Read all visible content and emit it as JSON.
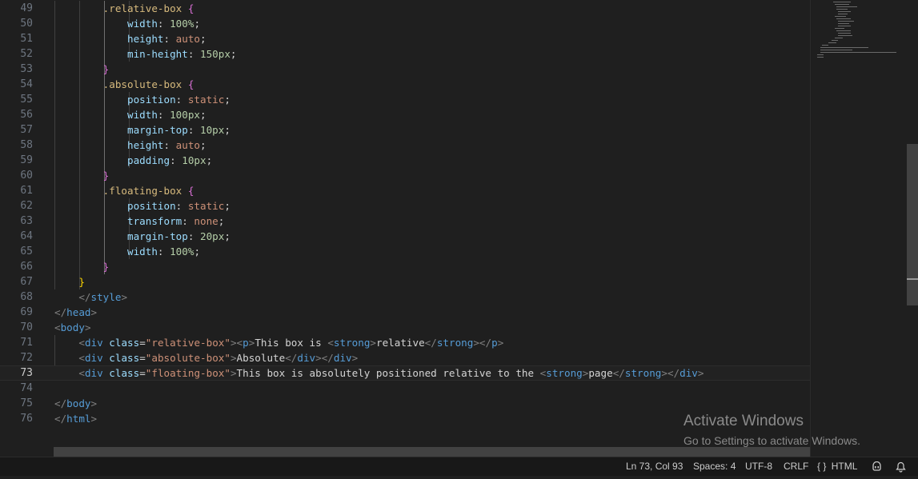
{
  "editor": {
    "lines": [
      {
        "number": "49",
        "tokens": [
          [
            "        ",
            ""
          ],
          [
            ".relative-box",
            "t-sel"
          ],
          [
            " ",
            "t-pun"
          ],
          [
            "{",
            "t-br2"
          ]
        ]
      },
      {
        "number": "50",
        "tokens": [
          [
            "            ",
            ""
          ],
          [
            "width",
            "t-prop"
          ],
          [
            ": ",
            "t-pun"
          ],
          [
            "100%",
            "t-num"
          ],
          [
            ";",
            "t-pun"
          ]
        ]
      },
      {
        "number": "51",
        "tokens": [
          [
            "            ",
            ""
          ],
          [
            "height",
            "t-prop"
          ],
          [
            ": ",
            "t-pun"
          ],
          [
            "auto",
            "t-val"
          ],
          [
            ";",
            "t-pun"
          ]
        ]
      },
      {
        "number": "52",
        "tokens": [
          [
            "            ",
            ""
          ],
          [
            "min-height",
            "t-prop"
          ],
          [
            ": ",
            "t-pun"
          ],
          [
            "150px",
            "t-num"
          ],
          [
            ";",
            "t-pun"
          ]
        ]
      },
      {
        "number": "53",
        "tokens": [
          [
            "        ",
            ""
          ],
          [
            "}",
            "t-br2"
          ]
        ]
      },
      {
        "number": "54",
        "tokens": [
          [
            "        ",
            ""
          ],
          [
            ".absolute-box",
            "t-sel"
          ],
          [
            " ",
            "t-pun"
          ],
          [
            "{",
            "t-br2"
          ]
        ]
      },
      {
        "number": "55",
        "tokens": [
          [
            "            ",
            ""
          ],
          [
            "position",
            "t-prop"
          ],
          [
            ": ",
            "t-pun"
          ],
          [
            "static",
            "t-val"
          ],
          [
            ";",
            "t-pun"
          ]
        ]
      },
      {
        "number": "56",
        "tokens": [
          [
            "            ",
            ""
          ],
          [
            "width",
            "t-prop"
          ],
          [
            ": ",
            "t-pun"
          ],
          [
            "100px",
            "t-num"
          ],
          [
            ";",
            "t-pun"
          ]
        ]
      },
      {
        "number": "57",
        "tokens": [
          [
            "            ",
            ""
          ],
          [
            "margin-top",
            "t-prop"
          ],
          [
            ": ",
            "t-pun"
          ],
          [
            "10px",
            "t-num"
          ],
          [
            ";",
            "t-pun"
          ]
        ]
      },
      {
        "number": "58",
        "tokens": [
          [
            "            ",
            ""
          ],
          [
            "height",
            "t-prop"
          ],
          [
            ": ",
            "t-pun"
          ],
          [
            "auto",
            "t-val"
          ],
          [
            ";",
            "t-pun"
          ]
        ]
      },
      {
        "number": "59",
        "tokens": [
          [
            "            ",
            ""
          ],
          [
            "padding",
            "t-prop"
          ],
          [
            ": ",
            "t-pun"
          ],
          [
            "10px",
            "t-num"
          ],
          [
            ";",
            "t-pun"
          ]
        ]
      },
      {
        "number": "60",
        "tokens": [
          [
            "        ",
            ""
          ],
          [
            "}",
            "t-br2"
          ]
        ]
      },
      {
        "number": "61",
        "tokens": [
          [
            "        ",
            ""
          ],
          [
            ".floating-box",
            "t-sel"
          ],
          [
            " ",
            "t-pun"
          ],
          [
            "{",
            "t-br2"
          ]
        ]
      },
      {
        "number": "62",
        "tokens": [
          [
            "            ",
            ""
          ],
          [
            "position",
            "t-prop"
          ],
          [
            ": ",
            "t-pun"
          ],
          [
            "static",
            "t-val"
          ],
          [
            ";",
            "t-pun"
          ]
        ]
      },
      {
        "number": "63",
        "tokens": [
          [
            "            ",
            ""
          ],
          [
            "transform",
            "t-prop"
          ],
          [
            ": ",
            "t-pun"
          ],
          [
            "none",
            "t-val"
          ],
          [
            ";",
            "t-pun"
          ]
        ]
      },
      {
        "number": "64",
        "tokens": [
          [
            "            ",
            ""
          ],
          [
            "margin-top",
            "t-prop"
          ],
          [
            ": ",
            "t-pun"
          ],
          [
            "20px",
            "t-num"
          ],
          [
            ";",
            "t-pun"
          ]
        ]
      },
      {
        "number": "65",
        "tokens": [
          [
            "            ",
            ""
          ],
          [
            "width",
            "t-prop"
          ],
          [
            ": ",
            "t-pun"
          ],
          [
            "100%",
            "t-num"
          ],
          [
            ";",
            "t-pun"
          ]
        ]
      },
      {
        "number": "66",
        "tokens": [
          [
            "        ",
            ""
          ],
          [
            "}",
            "t-br2"
          ]
        ]
      },
      {
        "number": "67",
        "tokens": [
          [
            "    ",
            ""
          ],
          [
            "}",
            "t-br1"
          ]
        ]
      },
      {
        "number": "68",
        "tokens": [
          [
            "    ",
            ""
          ],
          [
            "</",
            "t-tb"
          ],
          [
            "style",
            "t-tag"
          ],
          [
            ">",
            "t-tb"
          ]
        ]
      },
      {
        "number": "69",
        "tokens": [
          [
            "</",
            "t-tb"
          ],
          [
            "head",
            "t-tag"
          ],
          [
            ">",
            "t-tb"
          ]
        ]
      },
      {
        "number": "70",
        "tokens": [
          [
            "<",
            "t-tb"
          ],
          [
            "body",
            "t-tag"
          ],
          [
            ">",
            "t-tb"
          ]
        ]
      },
      {
        "number": "71",
        "tokens": [
          [
            "    ",
            ""
          ],
          [
            "<",
            "t-tb"
          ],
          [
            "div",
            "t-tag"
          ],
          [
            " ",
            "t-text"
          ],
          [
            "class",
            "t-attr"
          ],
          [
            "=",
            "t-text"
          ],
          [
            "\"relative-box\"",
            "t-str"
          ],
          [
            "><",
            "t-tb"
          ],
          [
            "p",
            "t-tag"
          ],
          [
            ">",
            "t-tb"
          ],
          [
            "This box is ",
            "t-text"
          ],
          [
            "<",
            "t-tb"
          ],
          [
            "strong",
            "t-tag"
          ],
          [
            ">",
            "t-tb"
          ],
          [
            "relative",
            "t-text"
          ],
          [
            "</",
            "t-tb"
          ],
          [
            "strong",
            "t-tag"
          ],
          [
            "></",
            "t-tb"
          ],
          [
            "p",
            "t-tag"
          ],
          [
            ">",
            "t-tb"
          ]
        ]
      },
      {
        "number": "72",
        "tokens": [
          [
            "    ",
            ""
          ],
          [
            "<",
            "t-tb"
          ],
          [
            "div",
            "t-tag"
          ],
          [
            " ",
            "t-text"
          ],
          [
            "class",
            "t-attr"
          ],
          [
            "=",
            "t-text"
          ],
          [
            "\"absolute-box\"",
            "t-str"
          ],
          [
            ">",
            "t-tb"
          ],
          [
            "Absolute",
            "t-text"
          ],
          [
            "</",
            "t-tb"
          ],
          [
            "div",
            "t-tag"
          ],
          [
            "></",
            "t-tb"
          ],
          [
            "div",
            "t-tag"
          ],
          [
            ">",
            "t-tb"
          ]
        ]
      },
      {
        "number": "73",
        "tokens": [
          [
            "    ",
            ""
          ],
          [
            "<",
            "t-tb"
          ],
          [
            "div",
            "t-tag"
          ],
          [
            " ",
            "t-text"
          ],
          [
            "class",
            "t-attr"
          ],
          [
            "=",
            "t-text"
          ],
          [
            "\"floating-box\"",
            "t-str"
          ],
          [
            ">",
            "t-tb"
          ],
          [
            "This box is absolutely positioned relative to the ",
            "t-text"
          ],
          [
            "<",
            "t-tb"
          ],
          [
            "strong",
            "t-tag"
          ],
          [
            ">",
            "t-tb"
          ],
          [
            "page",
            "t-text"
          ],
          [
            "</",
            "t-tb"
          ],
          [
            "strong",
            "t-tag"
          ],
          [
            "></",
            "t-tb"
          ],
          [
            "div",
            "t-tag"
          ],
          [
            ">",
            "t-tb"
          ]
        ]
      },
      {
        "number": "74",
        "tokens": []
      },
      {
        "number": "75",
        "tokens": [
          [
            "</",
            "t-tb"
          ],
          [
            "body",
            "t-tag"
          ],
          [
            ">",
            "t-tb"
          ]
        ]
      },
      {
        "number": "76",
        "tokens": [
          [
            "</",
            "t-tb"
          ],
          [
            "html",
            "t-tag"
          ],
          [
            ">",
            "t-tb"
          ]
        ]
      }
    ],
    "current_line": "73"
  },
  "watermark": {
    "title": "Activate Windows",
    "subtitle": "Go to Settings to activate Windows."
  },
  "statusbar": {
    "cursor_position": "Ln 73, Col 93",
    "indentation": "Spaces: 4",
    "encoding": "UTF-8",
    "line_ending": "CRLF",
    "language_icon": "{ }",
    "language": "HTML",
    "copilot_icon": "copilot-icon",
    "notifications_icon": "bell-icon"
  }
}
